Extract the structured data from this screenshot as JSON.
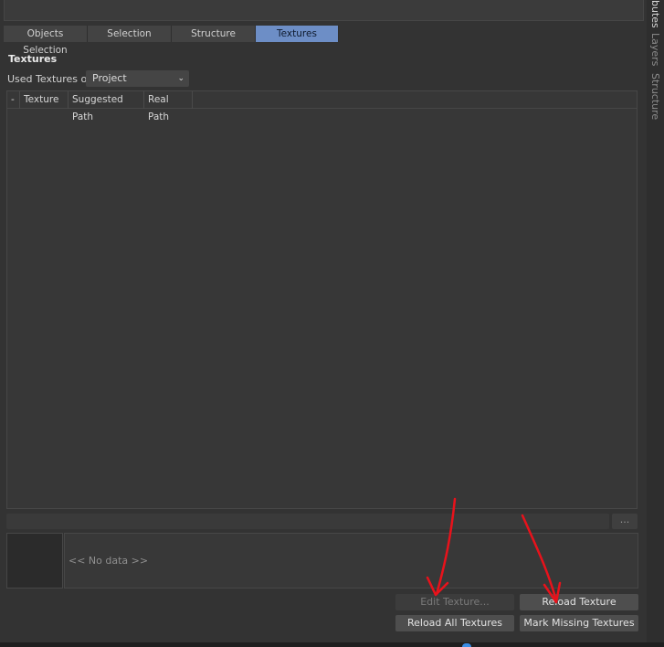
{
  "tabs": [
    {
      "label": "Objects Selection",
      "active": false
    },
    {
      "label": "Selection",
      "active": false
    },
    {
      "label": "Structure",
      "active": false
    },
    {
      "label": "Textures",
      "active": true
    }
  ],
  "section": {
    "title": "Textures"
  },
  "filter": {
    "label": "Used Textures of",
    "selected": "Project"
  },
  "table": {
    "columns": [
      "-",
      "Texture",
      "Suggested Path",
      "Real Path"
    ],
    "rows": []
  },
  "path": {
    "value": "",
    "browse_label": "..."
  },
  "info": {
    "no_data": "<< No data >>"
  },
  "buttons": {
    "edit_texture": "Edit Texture...",
    "reload_texture": "Reload Texture",
    "reload_all": "Reload All Textures",
    "mark_missing": "Mark Missing Textures"
  },
  "side_tabs": {
    "attributes": "butes",
    "layers": "Layers",
    "structure": "Structure"
  },
  "colors": {
    "active_tab": "#6d8ec6",
    "annotation": "#e8121b",
    "background": "#333333"
  }
}
